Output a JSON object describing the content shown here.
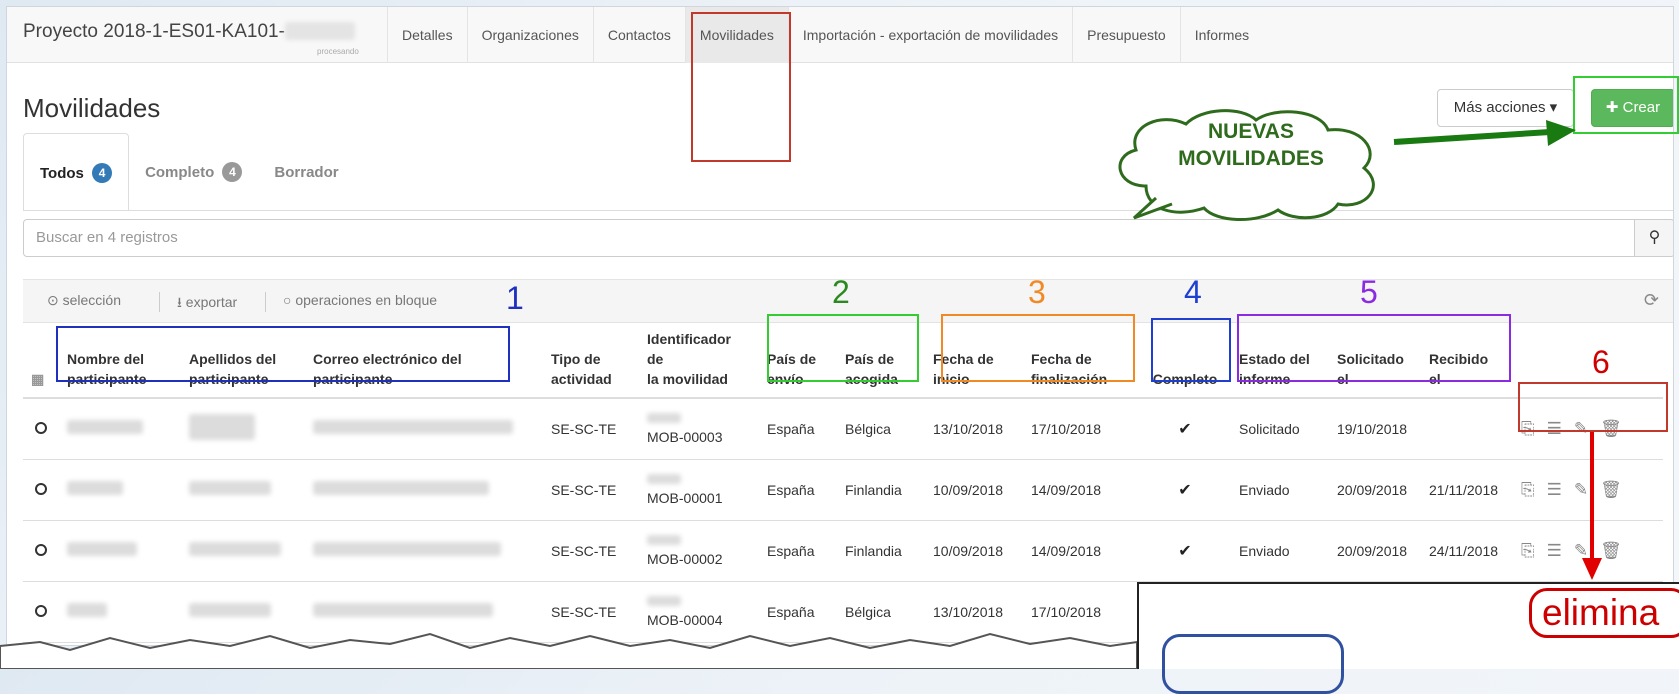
{
  "nav": {
    "project_title": "Proyecto 2018-1-ES01-KA101-",
    "project_status": "procesando",
    "tabs": [
      {
        "label": "Detalles"
      },
      {
        "label": "Organizaciones"
      },
      {
        "label": "Contactos"
      },
      {
        "label": "Movilidades"
      },
      {
        "label": "Importación - exportación de movilidades"
      },
      {
        "label": "Presupuesto"
      },
      {
        "label": "Informes"
      }
    ]
  },
  "page": {
    "title": "Movilidades",
    "more_actions": "Más acciones ▾",
    "create": "Crear"
  },
  "subtabs": [
    {
      "label": "Todos",
      "count": "4"
    },
    {
      "label": "Completo",
      "count": "4"
    },
    {
      "label": "Borrador",
      "count": ""
    }
  ],
  "search": {
    "placeholder": "Buscar en 4 registros",
    "icon": "search-icon"
  },
  "toolbar": {
    "select": "selección",
    "export": "exportar",
    "bulk": "operaciones en bloque",
    "refresh_icon": "refresh-icon"
  },
  "table": {
    "headers": [
      [
        "Nombre del",
        "participante"
      ],
      [
        "Apellidos del",
        "participante"
      ],
      [
        "Correo electrónico del",
        "participante"
      ],
      [
        "Tipo de",
        "actividad"
      ],
      [
        "Identificador de",
        "la movilidad"
      ],
      [
        "País de",
        "envío"
      ],
      [
        "País de",
        "acogida"
      ],
      [
        "Fecha de",
        "inicio"
      ],
      [
        "Fecha de",
        "finalización"
      ],
      [
        "",
        "Completo"
      ],
      [
        "Estado del",
        "informe"
      ],
      [
        "Solicitado",
        "el"
      ],
      [
        "Recibido",
        "el"
      ]
    ],
    "rows": [
      {
        "tipo": "SE-SC-TE",
        "id": "MOB-00003",
        "envio": "España",
        "acogida": "Bélgica",
        "inicio": "13/10/2018",
        "fin": "17/10/2018",
        "completo": "✔",
        "estado": "Solicitado",
        "solicitado": "19/10/2018",
        "recibido": ""
      },
      {
        "tipo": "SE-SC-TE",
        "id": "MOB-00001",
        "envio": "España",
        "acogida": "Finlandia",
        "inicio": "10/09/2018",
        "fin": "14/09/2018",
        "completo": "✔",
        "estado": "Enviado",
        "solicitado": "20/09/2018",
        "recibido": "21/11/2018"
      },
      {
        "tipo": "SE-SC-TE",
        "id": "MOB-00002",
        "envio": "España",
        "acogida": "Finlandia",
        "inicio": "10/09/2018",
        "fin": "14/09/2018",
        "completo": "✔",
        "estado": "Enviado",
        "solicitado": "20/09/2018",
        "recibido": "24/11/2018"
      },
      {
        "tipo": "SE-SC-TE",
        "id": "MOB-00004",
        "envio": "España",
        "acogida": "Bélgica",
        "inicio": "13/10/2018",
        "fin": "17/10/2018",
        "completo": "",
        "estado": "",
        "solicitado": "",
        "recibido": ""
      }
    ]
  },
  "annotations": {
    "n1": "1",
    "n2": "2",
    "n3": "3",
    "n4": "4",
    "n5": "5",
    "n6": "6",
    "callout_line1": "NUEVAS",
    "callout_line2": "MOVILIDADES",
    "elimina": "elimina",
    "colors": {
      "n1": "#1f2fbf",
      "n2": "#2a8a1f",
      "n3": "#f08a24",
      "n4": "#1f3fd0",
      "n5": "#8a2be2",
      "n6": "#d00000",
      "red_box": "#c0392b",
      "green_box": "#33cc33",
      "callout": "#2e6b1d"
    }
  }
}
